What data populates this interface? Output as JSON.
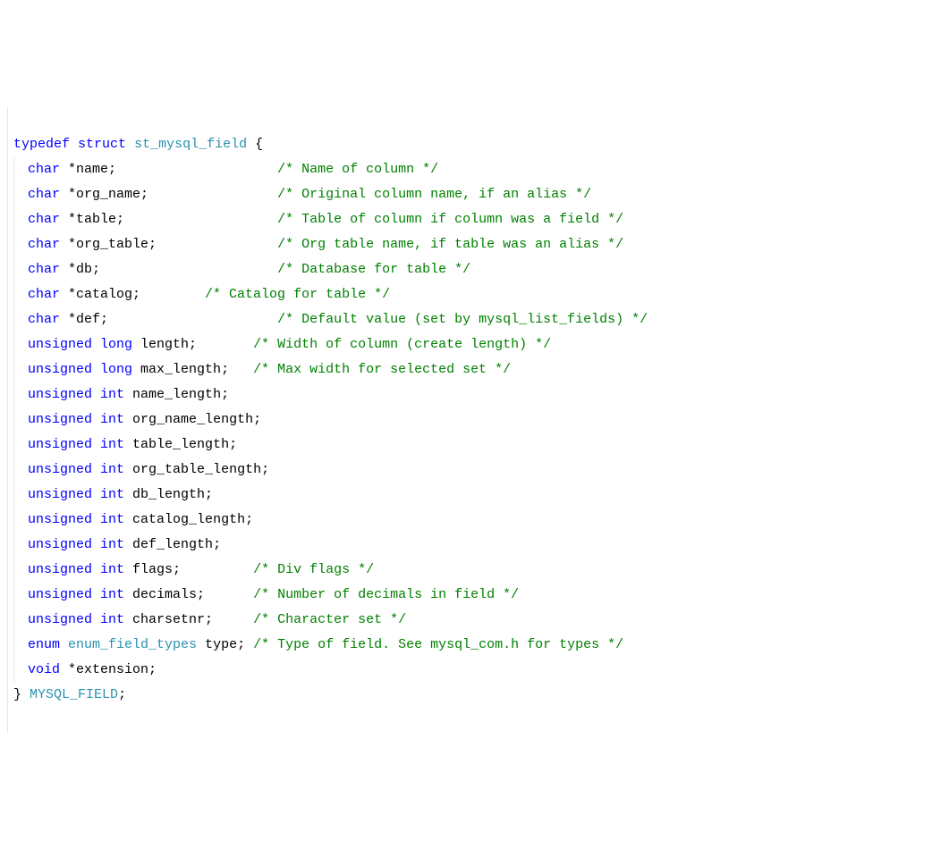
{
  "code": {
    "line1": {
      "typedef": "typedef",
      "struct": "struct",
      "name": "st_mysql_field",
      "brace": " {"
    },
    "fields": [
      {
        "type_kw": "char",
        "rest": " *name;",
        "pad": "                    ",
        "comment": "/* Name of column */"
      },
      {
        "type_kw": "char",
        "rest": " *org_name;",
        "pad": "                ",
        "comment": "/* Original column name, if an alias */"
      },
      {
        "type_kw": "char",
        "rest": " *table;",
        "pad": "                   ",
        "comment": "/* Table of column if column was a field */"
      },
      {
        "type_kw": "char",
        "rest": " *org_table;",
        "pad": "               ",
        "comment": "/* Org table name, if table was an alias */"
      },
      {
        "type_kw": "char",
        "rest": " *db;",
        "pad": "                      ",
        "comment": "/* Database for table */"
      },
      {
        "type_kw": "char",
        "rest": " *catalog;",
        "pad": "        ",
        "comment": "/* Catalog for table */"
      },
      {
        "type_kw": "char",
        "rest": " *def;",
        "pad": "                     ",
        "comment": "/* Default value (set by mysql_list_fields) */"
      },
      {
        "type_kw": "unsigned",
        "type_kw2": "long",
        "rest": " length;",
        "pad": "       ",
        "comment": "/* Width of column (create length) */"
      },
      {
        "type_kw": "unsigned",
        "type_kw2": "long",
        "rest": " max_length;",
        "pad": "   ",
        "comment": "/* Max width for selected set */"
      },
      {
        "type_kw": "unsigned",
        "type_kw2": "int",
        "rest": " name_length;",
        "pad": "",
        "comment": ""
      },
      {
        "type_kw": "unsigned",
        "type_kw2": "int",
        "rest": " org_name_length;",
        "pad": "",
        "comment": ""
      },
      {
        "type_kw": "unsigned",
        "type_kw2": "int",
        "rest": " table_length;",
        "pad": "",
        "comment": ""
      },
      {
        "type_kw": "unsigned",
        "type_kw2": "int",
        "rest": " org_table_length;",
        "pad": "",
        "comment": ""
      },
      {
        "type_kw": "unsigned",
        "type_kw2": "int",
        "rest": " db_length;",
        "pad": "",
        "comment": ""
      },
      {
        "type_kw": "unsigned",
        "type_kw2": "int",
        "rest": " catalog_length;",
        "pad": "",
        "comment": ""
      },
      {
        "type_kw": "unsigned",
        "type_kw2": "int",
        "rest": " def_length;",
        "pad": "",
        "comment": ""
      },
      {
        "type_kw": "unsigned",
        "type_kw2": "int",
        "rest": " flags;",
        "pad": "         ",
        "comment": "/* Div flags */"
      },
      {
        "type_kw": "unsigned",
        "type_kw2": "int",
        "rest": " decimals;",
        "pad": "      ",
        "comment": "/* Number of decimals in field */"
      },
      {
        "type_kw": "unsigned",
        "type_kw2": "int",
        "rest": " charsetnr;",
        "pad": "     ",
        "comment": "/* Character set */"
      },
      {
        "type_kw": "enum",
        "typename": "enum_field_types",
        "rest": " type;",
        "pad": " ",
        "comment": "/* Type of field. See mysql_com.h for types */"
      },
      {
        "type_kw": "void",
        "rest": " *extension;",
        "pad": "",
        "comment": ""
      }
    ],
    "close": {
      "brace": "}",
      "alias": "MYSQL_FIELD",
      "semi": ";"
    }
  }
}
